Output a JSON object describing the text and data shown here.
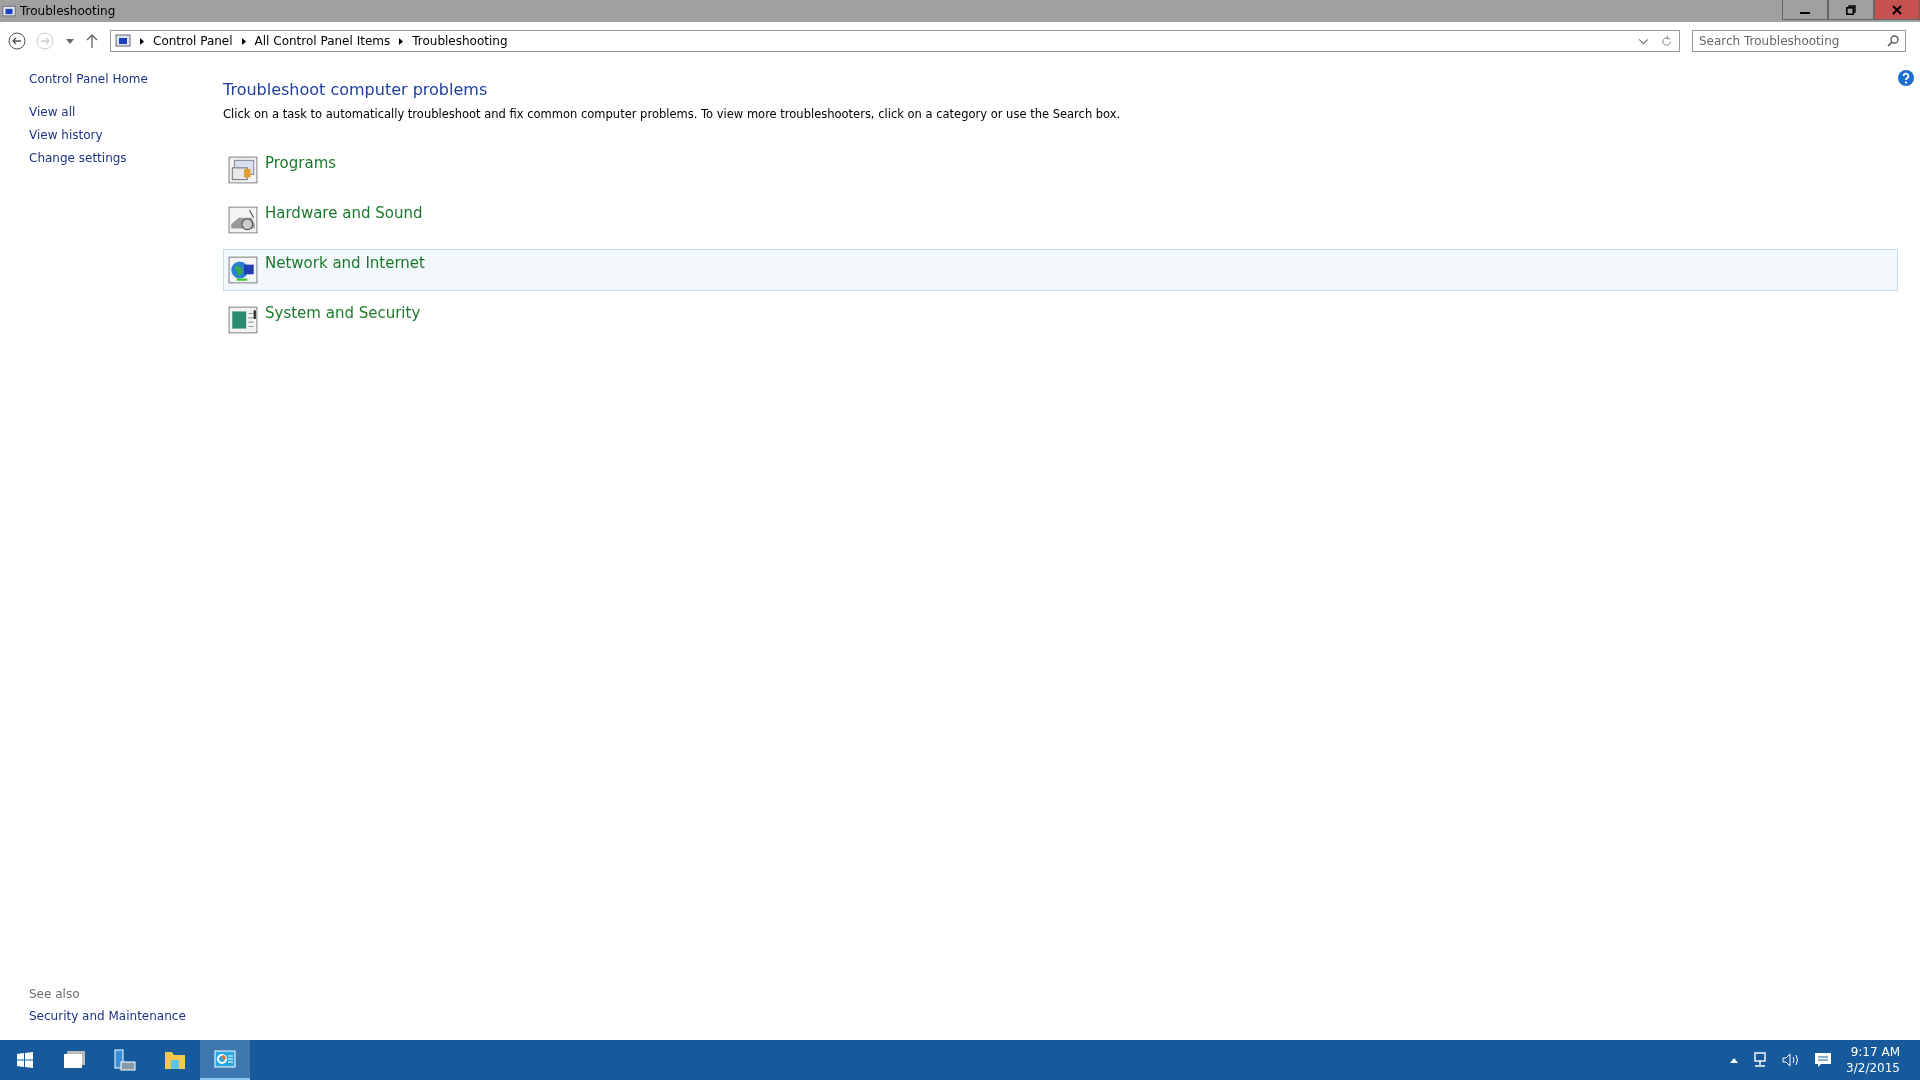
{
  "window": {
    "title": "Troubleshooting"
  },
  "address_bar": {
    "path": [
      "Control Panel",
      "All Control Panel Items",
      "Troubleshooting"
    ]
  },
  "search": {
    "placeholder": "Search Troubleshooting"
  },
  "sidebar": {
    "home": "Control Panel Home",
    "links": [
      "View all",
      "View history",
      "Change settings"
    ],
    "see_also_title": "See also",
    "see_also": [
      "Security and Maintenance"
    ]
  },
  "main": {
    "title": "Troubleshoot computer problems",
    "description": "Click on a task to automatically troubleshoot and fix common computer problems. To view more troubleshooters, click on a category or use the Search box.",
    "categories": [
      {
        "label": "Programs",
        "kind": "programs",
        "selected": false
      },
      {
        "label": "Hardware and Sound",
        "kind": "hardware",
        "selected": false
      },
      {
        "label": "Network and Internet",
        "kind": "network",
        "selected": true
      },
      {
        "label": "System and Security",
        "kind": "system",
        "selected": false
      }
    ]
  },
  "taskbar": {
    "apps": [
      {
        "kind": "taskview",
        "selected": false
      },
      {
        "kind": "server",
        "selected": false
      },
      {
        "kind": "folder",
        "selected": false
      },
      {
        "kind": "control",
        "selected": true
      }
    ],
    "time": "9:17 AM",
    "date": "3/2/2015"
  }
}
